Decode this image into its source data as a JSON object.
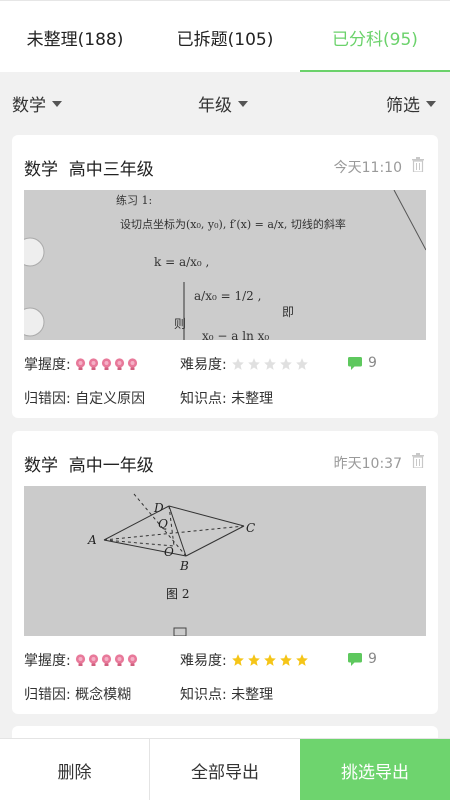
{
  "tabs": [
    {
      "label": "未整理(188)"
    },
    {
      "label": "已拆题(105)"
    },
    {
      "label": "已分科(95)",
      "active": true
    }
  ],
  "filters": {
    "subject": "数学",
    "grade": "年级",
    "filter": "筛选"
  },
  "cards": [
    {
      "title": "数学  高中三年级",
      "time": "今天11:10",
      "mastery_label": "掌握度:",
      "mastery_level": 5,
      "difficulty_label": "难易度:",
      "difficulty_stars": 0,
      "comment_count": "9",
      "error_reason": "归错因: 自定义原因",
      "knowledge": "知识点: 未整理",
      "photo_text": {
        "l1": "练习 1:",
        "l2": "设切点坐标为(x₀, y₀), f′(x) = a/x, 切线的斜率",
        "l3": "k = a/x₀ ,",
        "l4": "a/x₀ = 1/2 ,",
        "l5": "则",
        "l6": "即",
        "l7": "x₀ − a ln x₀"
      }
    },
    {
      "title": "数学  高中一年级",
      "time": "昨天10:37",
      "mastery_label": "掌握度:",
      "mastery_level": 5,
      "difficulty_label": "难易度:",
      "difficulty_stars": 5,
      "comment_count": "9",
      "error_reason": "归错因: 概念模糊",
      "knowledge": "知识点: 未整理",
      "photo_text": {
        "a": "A",
        "b": "B",
        "c": "C",
        "d": "D",
        "o": "O",
        "q": "Q",
        "fig": "图 2"
      }
    }
  ],
  "bottom": {
    "delete": "删除",
    "export_all": "全部导出",
    "export_selected": "挑选导出"
  },
  "colors": {
    "accent": "#6bd26b",
    "mastery_dot": "#e8799a",
    "star_filled": "#f5c518",
    "star_empty": "#e0e0e0"
  }
}
